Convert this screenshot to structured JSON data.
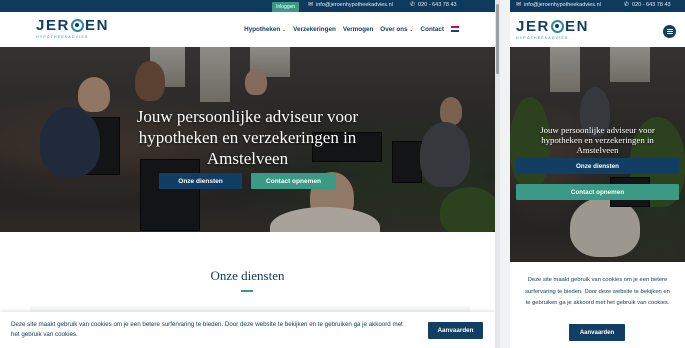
{
  "brand": {
    "logo_pre": "JER",
    "logo_post": "EN",
    "tagline": "HYPOTHEEKADVIES"
  },
  "topbar": {
    "login_label": "Inloggen",
    "email": "info@jeroenhypotheekadvies.nl",
    "phone": "020 - 643 78 43",
    "mail_icon": "mail-icon",
    "phone_icon": "phone-icon"
  },
  "nav": {
    "items": [
      "Hypotheken",
      "Verzekeringen",
      "Vermogen",
      "Over ons",
      "Contact"
    ],
    "dropdown_icon": "chevron-down-icon",
    "language_icon": "uk-flag-icon"
  },
  "hero": {
    "line1": "Jouw persoonlijke adviseur voor",
    "line2": "hypotheken en verzekeringen in",
    "line3": "Amstelveen",
    "primary_button": "Onze diensten",
    "secondary_button": "Contact opnemen"
  },
  "services": {
    "title": "Onze diensten"
  },
  "cookie": {
    "text": "Deze site maakt gebruik van cookies om je een betere surfervaring te bieden. Door deze website te bekijken en te gebruiken ga je akkoord met het gebruik van cookies.",
    "accept_label": "Aanvaarden"
  },
  "colors": {
    "navy": "#123e63",
    "teal": "#3a9a86",
    "topbar": "#0e3a5e"
  }
}
